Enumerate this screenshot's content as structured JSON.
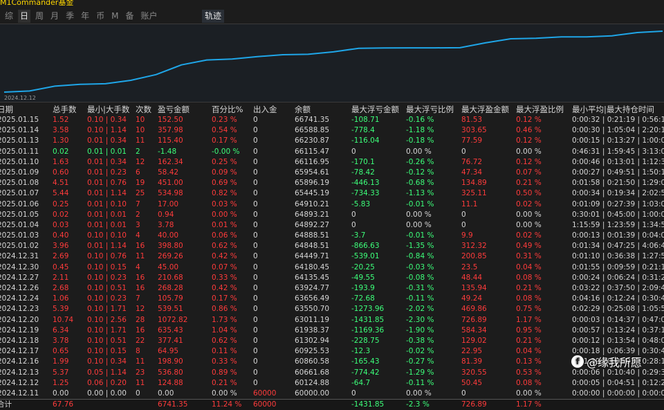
{
  "app_title": "M1Commander基金",
  "tabs": [
    "综",
    "日",
    "周",
    "月",
    "季",
    "年",
    "币",
    "M",
    "备",
    "账户"
  ],
  "active_tab": "日",
  "track_tab": "轨迹",
  "chart_start_label": "2024.12.12",
  "chart_data": {
    "type": "line",
    "x": [
      "2024.12.11",
      "2024.12.12",
      "2024.12.13",
      "2024.12.16",
      "2024.12.17",
      "2024.12.18",
      "2024.12.19",
      "2024.12.20",
      "2024.12.23",
      "2024.12.24",
      "2024.12.26",
      "2024.12.27",
      "2024.12.30",
      "2024.12.31",
      "2025.01.02",
      "2025.01.03",
      "2025.01.04",
      "2025.01.05",
      "2025.01.06",
      "2025.01.07",
      "2025.01.08",
      "2025.01.09",
      "2025.01.10",
      "2025.01.11",
      "2025.01.13",
      "2025.01.14",
      "2025.01.15"
    ],
    "values": [
      60000.0,
      60124.88,
      60661.68,
      60860.58,
      60925.53,
      61302.94,
      61938.37,
      63011.19,
      63550.7,
      63656.49,
      63924.77,
      64135.45,
      64180.45,
      64449.71,
      64848.51,
      64888.51,
      64892.27,
      64893.21,
      64910.21,
      65445.19,
      65896.19,
      65954.61,
      66116.95,
      66115.47,
      66230.87,
      66588.85,
      66741.35
    ],
    "color": "#1fa6e8"
  },
  "columns": [
    "日期",
    "总手数",
    "最小|大手数",
    "次数",
    "盈亏金额",
    "百分比%",
    "出入金",
    "余额",
    "最大浮亏金额",
    "最大浮亏比例",
    "最大浮盈金额",
    "最大浮盈比例",
    "最小平均|最大持仓时间"
  ],
  "rows": [
    {
      "date": "2025.01.15",
      "lots": "1.52",
      "minmax": "0.10 | 0.34",
      "count": "10",
      "pnl": "152.50",
      "pct": "0.23 %",
      "io": "0",
      "bal": "66741.35",
      "fl": "-108.71",
      "flp": "-0.16 %",
      "fp": "81.53",
      "fpp": "0.12 %",
      "time": "0:00:32 | 0:21:19 | 0:56:11",
      "c": "red"
    },
    {
      "date": "2025.01.14",
      "lots": "3.58",
      "minmax": "0.10 | 1.14",
      "count": "10",
      "pnl": "357.98",
      "pct": "0.54 %",
      "io": "0",
      "bal": "66588.85",
      "fl": "-778.4",
      "flp": "-1.18 %",
      "fp": "303.65",
      "fpp": "0.46 %",
      "time": "0:00:30 | 1:05:04 | 2:20:16",
      "c": "red"
    },
    {
      "date": "2025.01.13",
      "lots": "1.30",
      "minmax": "0.01 | 0.34",
      "count": "11",
      "pnl": "115.40",
      "pct": "0.17 %",
      "io": "0",
      "bal": "66230.87",
      "fl": "-116.04",
      "flp": "-0.18 %",
      "fp": "77.59",
      "fpp": "0.12 %",
      "time": "0:00:15 | 0:13:27 | 1:00:01",
      "c": "red"
    },
    {
      "date": "2025.01.11",
      "lots": "0.02",
      "minmax": "0.01 | 0.01",
      "count": "2",
      "pnl": "-1.48",
      "pct": "-0.00 %",
      "io": "0",
      "bal": "66115.47",
      "fl": "0",
      "flp": "0.00 %",
      "fp": "0",
      "fpp": "0.00 %",
      "time": "0:46:31 | 1:59:45 | 3:13:00",
      "c": "green"
    },
    {
      "date": "2025.01.10",
      "lots": "1.63",
      "minmax": "0.01 | 0.34",
      "count": "12",
      "pnl": "162.34",
      "pct": "0.25 %",
      "io": "0",
      "bal": "66116.95",
      "fl": "-170.1",
      "flp": "-0.26 %",
      "fp": "76.72",
      "fpp": "0.12 %",
      "time": "0:00:46 | 0:13:01 | 1:12:33",
      "c": "red"
    },
    {
      "date": "2025.01.09",
      "lots": "0.60",
      "minmax": "0.01 | 0.23",
      "count": "6",
      "pnl": "58.42",
      "pct": "0.09 %",
      "io": "0",
      "bal": "65954.61",
      "fl": "-78.42",
      "flp": "-0.12 %",
      "fp": "47.34",
      "fpp": "0.07 %",
      "time": "0:00:27 | 0:49:51 | 1:50:12",
      "c": "red"
    },
    {
      "date": "2025.01.08",
      "lots": "4.51",
      "minmax": "0.01 | 0.76",
      "count": "19",
      "pnl": "451.00",
      "pct": "0.69 %",
      "io": "0",
      "bal": "65896.19",
      "fl": "-446.13",
      "flp": "-0.68 %",
      "fp": "134.89",
      "fpp": "0.21 %",
      "time": "0:01:58 | 0:21:50 | 1:29:02",
      "c": "red"
    },
    {
      "date": "2025.01.07",
      "lots": "5.44",
      "minmax": "0.01 | 1.14",
      "count": "25",
      "pnl": "534.98",
      "pct": "0.82 %",
      "io": "0",
      "bal": "65445.19",
      "fl": "-734.33",
      "flp": "-1.13 %",
      "fp": "325.11",
      "fpp": "0.50 %",
      "time": "0:00:34 | 0:19:34 | 2:02:59",
      "c": "red"
    },
    {
      "date": "2025.01.06",
      "lots": "0.25",
      "minmax": "0.01 | 0.10",
      "count": "7",
      "pnl": "17.00",
      "pct": "0.03 %",
      "io": "0",
      "bal": "64910.21",
      "fl": "-5.83",
      "flp": "-0.01 %",
      "fp": "11.1",
      "fpp": "0.02 %",
      "time": "0:01:09 | 0:27:39 | 1:03:09",
      "c": "red"
    },
    {
      "date": "2025.01.05",
      "lots": "0.02",
      "minmax": "0.01 | 0.01",
      "count": "2",
      "pnl": "0.94",
      "pct": "0.00 %",
      "io": "0",
      "bal": "64893.21",
      "fl": "0",
      "flp": "0.00 %",
      "fp": "0",
      "fpp": "0.00 %",
      "time": "0:30:01 | 0:45:00 | 1:00:00",
      "c": "red"
    },
    {
      "date": "2025.01.04",
      "lots": "0.03",
      "minmax": "0.01 | 0.01",
      "count": "3",
      "pnl": "3.78",
      "pct": "0.01 %",
      "io": "0",
      "bal": "64892.27",
      "fl": "0",
      "flp": "0.00 %",
      "fp": "0",
      "fpp": "0.00 %",
      "time": "1:15:59 | 1:23:59 | 1:34:58",
      "c": "red"
    },
    {
      "date": "2025.01.03",
      "lots": "0.40",
      "minmax": "0.10 | 0.10",
      "count": "4",
      "pnl": "40.00",
      "pct": "0.06 %",
      "io": "0",
      "bal": "64888.51",
      "fl": "-3.7",
      "flp": "-0.01 %",
      "fp": "9.9",
      "fpp": "0.02 %",
      "time": "0:00:13 | 0:01:39 | 0:04:02",
      "c": "red"
    },
    {
      "date": "2025.01.02",
      "lots": "3.96",
      "minmax": "0.01 | 1.14",
      "count": "16",
      "pnl": "398.80",
      "pct": "0.62 %",
      "io": "0",
      "bal": "64848.51",
      "fl": "-866.63",
      "flp": "-1.35 %",
      "fp": "312.32",
      "fpp": "0.49 %",
      "time": "0:01:34 | 0:47:25 | 4:06:41",
      "c": "red"
    },
    {
      "date": "2024.12.31",
      "lots": "2.69",
      "minmax": "0.10 | 0.76",
      "count": "11",
      "pnl": "269.26",
      "pct": "0.42 %",
      "io": "0",
      "bal": "64449.71",
      "fl": "-539.01",
      "flp": "-0.84 %",
      "fp": "200.85",
      "fpp": "0.31 %",
      "time": "0:01:10 | 0:36:38 | 1:27:56",
      "c": "red"
    },
    {
      "date": "2024.12.30",
      "lots": "0.45",
      "minmax": "0.10 | 0.15",
      "count": "4",
      "pnl": "45.00",
      "pct": "0.07 %",
      "io": "0",
      "bal": "64180.45",
      "fl": "-20.25",
      "flp": "-0.03 %",
      "fp": "23.5",
      "fpp": "0.04 %",
      "time": "0:01:55 | 0:09:59 | 0:21:18",
      "c": "red"
    },
    {
      "date": "2024.12.27",
      "lots": "2.11",
      "minmax": "0.10 | 0.23",
      "count": "16",
      "pnl": "210.68",
      "pct": "0.33 %",
      "io": "0",
      "bal": "64135.45",
      "fl": "-49.55",
      "flp": "-0.08 %",
      "fp": "48.44",
      "fpp": "0.08 %",
      "time": "0:00:24 | 0:06:24 | 0:31:20",
      "c": "red"
    },
    {
      "date": "2024.12.26",
      "lots": "2.68",
      "minmax": "0.10 | 0.51",
      "count": "16",
      "pnl": "268.28",
      "pct": "0.42 %",
      "io": "0",
      "bal": "63924.77",
      "fl": "-193.9",
      "flp": "-0.31 %",
      "fp": "135.94",
      "fpp": "0.21 %",
      "time": "0:03:22 | 0:37:50 | 2:09:47",
      "c": "red"
    },
    {
      "date": "2024.12.24",
      "lots": "1.06",
      "minmax": "0.10 | 0.23",
      "count": "7",
      "pnl": "105.79",
      "pct": "0.17 %",
      "io": "0",
      "bal": "63656.49",
      "fl": "-72.68",
      "flp": "-0.11 %",
      "fp": "49.24",
      "fpp": "0.08 %",
      "time": "0:04:16 | 0:12:24 | 0:30:47",
      "c": "red"
    },
    {
      "date": "2024.12.23",
      "lots": "5.39",
      "minmax": "0.10 | 1.71",
      "count": "12",
      "pnl": "539.51",
      "pct": "0.86 %",
      "io": "0",
      "bal": "63550.70",
      "fl": "-1273.96",
      "flp": "-2.02 %",
      "fp": "469.86",
      "fpp": "0.75 %",
      "time": "0:02:29 | 0:25:08 | 1:05:58",
      "c": "red"
    },
    {
      "date": "2024.12.20",
      "lots": "10.74",
      "minmax": "0.10 | 2.56",
      "count": "28",
      "pnl": "1072.82",
      "pct": "1.73 %",
      "io": "0",
      "bal": "63011.19",
      "fl": "-1431.85",
      "flp": "-2.30 %",
      "fp": "726.89",
      "fpp": "1.17 %",
      "time": "0:00:03 | 0:14:37 | 0:47:04",
      "c": "red"
    },
    {
      "date": "2024.12.19",
      "lots": "6.34",
      "minmax": "0.10 | 1.71",
      "count": "16",
      "pnl": "635.43",
      "pct": "1.04 %",
      "io": "0",
      "bal": "61938.37",
      "fl": "-1169.36",
      "flp": "-1.90 %",
      "fp": "584.34",
      "fpp": "0.95 %",
      "time": "0:00:57 | 0:13:24 | 0:37:14",
      "c": "red"
    },
    {
      "date": "2024.12.18",
      "lots": "3.78",
      "minmax": "0.10 | 0.51",
      "count": "22",
      "pnl": "377.41",
      "pct": "0.62 %",
      "io": "0",
      "bal": "61302.94",
      "fl": "-228.75",
      "flp": "-0.38 %",
      "fp": "129.02",
      "fpp": "0.21 %",
      "time": "0:00:12 | 0:13:54 | 0:48:09",
      "c": "red"
    },
    {
      "date": "2024.12.17",
      "lots": "0.65",
      "minmax": "0.10 | 0.15",
      "count": "8",
      "pnl": "64.95",
      "pct": "0.11 %",
      "io": "0",
      "bal": "60925.53",
      "fl": "-12.3",
      "flp": "-0.02 %",
      "fp": "22.95",
      "fpp": "0.04 %",
      "time": "0:00:18 | 0:06:39 | 0:30:42",
      "c": "red"
    },
    {
      "date": "2024.12.16",
      "lots": "1.99",
      "minmax": "0.10 | 0.34",
      "count": "11",
      "pnl": "198.90",
      "pct": "0.33 %",
      "io": "0",
      "bal": "60860.58",
      "fl": "-165.43",
      "flp": "-0.27 %",
      "fp": "81.39",
      "fpp": "0.13 %",
      "time": "0:01:39 | 0:10:03 | 0:28:14",
      "c": "red"
    },
    {
      "date": "2024.12.13",
      "lots": "5.37",
      "minmax": "0.05 | 1.14",
      "count": "23",
      "pnl": "536.80",
      "pct": "0.89 %",
      "io": "0",
      "bal": "60661.68",
      "fl": "-774.42",
      "flp": "-1.29 %",
      "fp": "320.55",
      "fpp": "0.53 %",
      "time": "0:00:06 | 0:10:40 | 0:29:32",
      "c": "red"
    },
    {
      "date": "2024.12.12",
      "lots": "1.25",
      "minmax": "0.06 | 0.20",
      "count": "11",
      "pnl": "124.88",
      "pct": "0.21 %",
      "io": "0",
      "bal": "60124.88",
      "fl": "-64.7",
      "flp": "-0.11 %",
      "fp": "50.45",
      "fpp": "0.08 %",
      "time": "0:00:05 | 0:04:51 | 0:12:20",
      "c": "red"
    },
    {
      "date": "2024.12.11",
      "lots": "0.00",
      "minmax": "0.00 | 0.00",
      "count": "0",
      "pnl": "0.00",
      "pct": "0.00 %",
      "io": "60000",
      "bal": "60000.00",
      "fl": "0",
      "flp": "0.00 %",
      "fp": "0",
      "fpp": "0.00 %",
      "time": "0:00:00 | 0:00:00 | 0:00:00",
      "c": "white"
    }
  ],
  "total": {
    "label": "合计",
    "lots": "67.76",
    "pnl": "6741.35",
    "pct": "11.24 %",
    "io": "60000",
    "fl": "-1431.85",
    "flp": "-2.3 %",
    "fp": "726.89",
    "fpp": "1.17 %"
  },
  "watermark": "@缘我所愿",
  "watermark_icon": "f-icon",
  "colors": {
    "profit": "#ff3b3b",
    "loss": "#3cff7a",
    "line": "#1fa6e8",
    "title": "#ffd700"
  }
}
